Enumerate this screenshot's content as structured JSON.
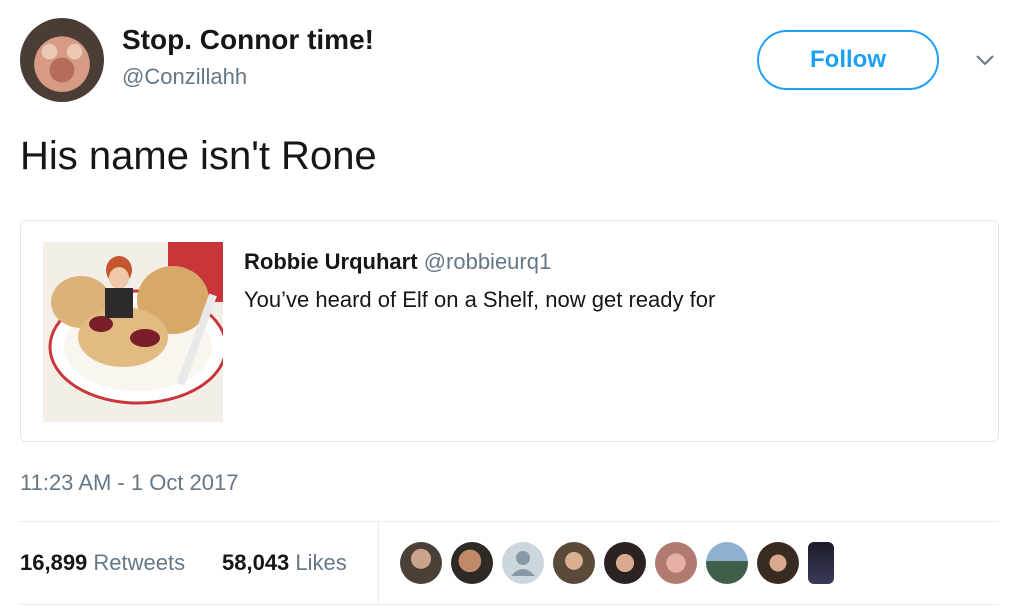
{
  "author": {
    "display_name": "Stop. Connor time!",
    "handle": "@Conzillahh"
  },
  "follow_button": {
    "label": "Follow",
    "color": "#1da1f2"
  },
  "tweet": {
    "text": "His name isn't Rone"
  },
  "quote": {
    "author_name": "Robbie Urquhart",
    "author_handle": "@robbieurq1",
    "text": "You’ve heard of Elf on a Shelf, now get ready for",
    "image_icon": "photo-thumbnail"
  },
  "meta": {
    "timestamp": "11:23 AM - 1 Oct 2017"
  },
  "stats": {
    "retweets_count": "16,899",
    "retweets_label": "Retweets",
    "likes_count": "58,043",
    "likes_label": "Likes"
  },
  "likers": [
    {
      "icon": "liker-avatar"
    },
    {
      "icon": "liker-avatar"
    },
    {
      "icon": "default-avatar"
    },
    {
      "icon": "liker-avatar"
    },
    {
      "icon": "liker-avatar"
    },
    {
      "icon": "liker-avatar"
    },
    {
      "icon": "liker-avatar"
    },
    {
      "icon": "liker-avatar"
    },
    {
      "icon": "liker-avatar"
    }
  ]
}
